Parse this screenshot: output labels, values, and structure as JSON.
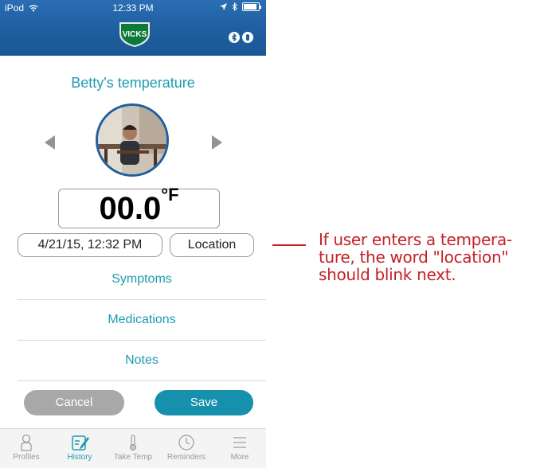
{
  "status": {
    "carrier": "iPod",
    "time": "12:33 PM"
  },
  "header": {
    "logo_text": "VICKS",
    "bluetooth_icon": "bluetooth-icon",
    "probe_icon": "thermometer-probe-icon"
  },
  "profile": {
    "title": "Betty's temperature",
    "prev_icon": "left-triangle-icon",
    "next_icon": "right-triangle-icon"
  },
  "reading": {
    "value": "00.0",
    "unit": "°F"
  },
  "details": {
    "datetime": "4/21/15, 12:32 PM",
    "location_label": "Location"
  },
  "rows": {
    "symptoms": "Symptoms",
    "medications": "Medications",
    "notes": "Notes"
  },
  "actions": {
    "cancel": "Cancel",
    "save": "Save"
  },
  "tabbar": {
    "items": [
      {
        "label": "Profiles",
        "icon": "profile-icon"
      },
      {
        "label": "History",
        "icon": "history-icon",
        "active": true
      },
      {
        "label": "Take Temp",
        "icon": "thermometer-icon"
      },
      {
        "label": "Reminders",
        "icon": "clock-icon"
      },
      {
        "label": "More",
        "icon": "menu-icon"
      }
    ]
  },
  "annotation": {
    "line1": "If user enters a tempera-",
    "line2": "ture, the word \"location\"",
    "line3": "should blink next."
  },
  "colors": {
    "header_blue": "#1f5f9f",
    "accent_teal": "#1e9cb2",
    "save_button": "#1690ad",
    "cancel_button": "#a8a8a8",
    "annotation_red": "#c42127"
  }
}
